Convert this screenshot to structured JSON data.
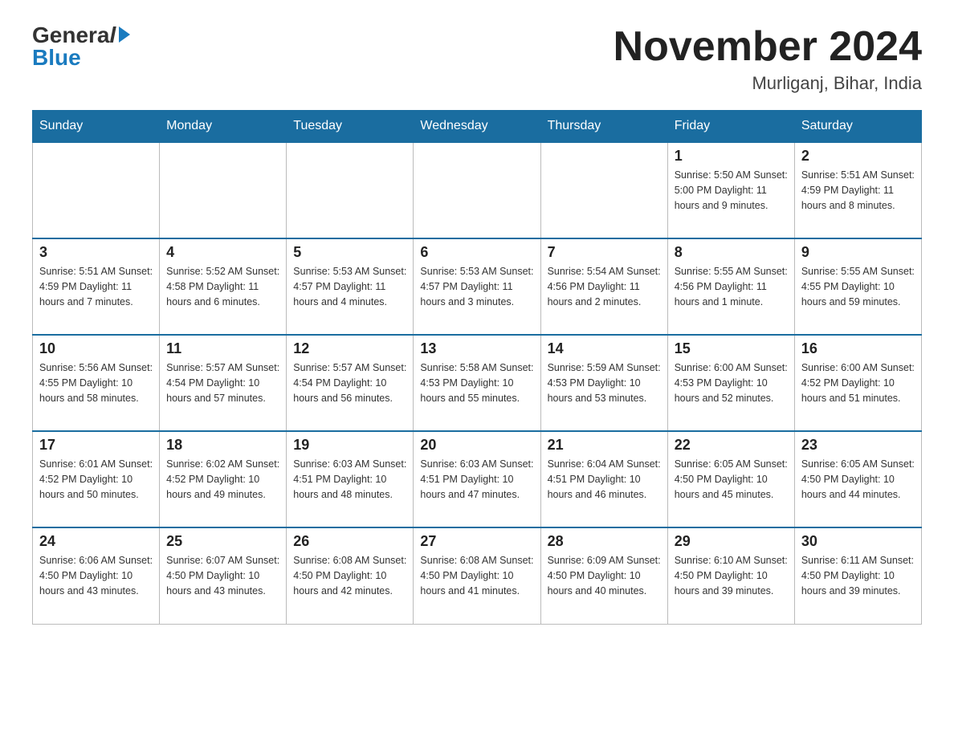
{
  "header": {
    "logo_general": "General",
    "logo_blue": "Blue",
    "month_title": "November 2024",
    "location": "Murliganj, Bihar, India"
  },
  "days_of_week": [
    "Sunday",
    "Monday",
    "Tuesday",
    "Wednesday",
    "Thursday",
    "Friday",
    "Saturday"
  ],
  "weeks": [
    [
      {
        "day": "",
        "info": "",
        "empty": true
      },
      {
        "day": "",
        "info": "",
        "empty": true
      },
      {
        "day": "",
        "info": "",
        "empty": true
      },
      {
        "day": "",
        "info": "",
        "empty": true
      },
      {
        "day": "",
        "info": "",
        "empty": true
      },
      {
        "day": "1",
        "info": "Sunrise: 5:50 AM\nSunset: 5:00 PM\nDaylight: 11 hours\nand 9 minutes."
      },
      {
        "day": "2",
        "info": "Sunrise: 5:51 AM\nSunset: 4:59 PM\nDaylight: 11 hours\nand 8 minutes."
      }
    ],
    [
      {
        "day": "3",
        "info": "Sunrise: 5:51 AM\nSunset: 4:59 PM\nDaylight: 11 hours\nand 7 minutes."
      },
      {
        "day": "4",
        "info": "Sunrise: 5:52 AM\nSunset: 4:58 PM\nDaylight: 11 hours\nand 6 minutes."
      },
      {
        "day": "5",
        "info": "Sunrise: 5:53 AM\nSunset: 4:57 PM\nDaylight: 11 hours\nand 4 minutes."
      },
      {
        "day": "6",
        "info": "Sunrise: 5:53 AM\nSunset: 4:57 PM\nDaylight: 11 hours\nand 3 minutes."
      },
      {
        "day": "7",
        "info": "Sunrise: 5:54 AM\nSunset: 4:56 PM\nDaylight: 11 hours\nand 2 minutes."
      },
      {
        "day": "8",
        "info": "Sunrise: 5:55 AM\nSunset: 4:56 PM\nDaylight: 11 hours\nand 1 minute."
      },
      {
        "day": "9",
        "info": "Sunrise: 5:55 AM\nSunset: 4:55 PM\nDaylight: 10 hours\nand 59 minutes."
      }
    ],
    [
      {
        "day": "10",
        "info": "Sunrise: 5:56 AM\nSunset: 4:55 PM\nDaylight: 10 hours\nand 58 minutes."
      },
      {
        "day": "11",
        "info": "Sunrise: 5:57 AM\nSunset: 4:54 PM\nDaylight: 10 hours\nand 57 minutes."
      },
      {
        "day": "12",
        "info": "Sunrise: 5:57 AM\nSunset: 4:54 PM\nDaylight: 10 hours\nand 56 minutes."
      },
      {
        "day": "13",
        "info": "Sunrise: 5:58 AM\nSunset: 4:53 PM\nDaylight: 10 hours\nand 55 minutes."
      },
      {
        "day": "14",
        "info": "Sunrise: 5:59 AM\nSunset: 4:53 PM\nDaylight: 10 hours\nand 53 minutes."
      },
      {
        "day": "15",
        "info": "Sunrise: 6:00 AM\nSunset: 4:53 PM\nDaylight: 10 hours\nand 52 minutes."
      },
      {
        "day": "16",
        "info": "Sunrise: 6:00 AM\nSunset: 4:52 PM\nDaylight: 10 hours\nand 51 minutes."
      }
    ],
    [
      {
        "day": "17",
        "info": "Sunrise: 6:01 AM\nSunset: 4:52 PM\nDaylight: 10 hours\nand 50 minutes."
      },
      {
        "day": "18",
        "info": "Sunrise: 6:02 AM\nSunset: 4:52 PM\nDaylight: 10 hours\nand 49 minutes."
      },
      {
        "day": "19",
        "info": "Sunrise: 6:03 AM\nSunset: 4:51 PM\nDaylight: 10 hours\nand 48 minutes."
      },
      {
        "day": "20",
        "info": "Sunrise: 6:03 AM\nSunset: 4:51 PM\nDaylight: 10 hours\nand 47 minutes."
      },
      {
        "day": "21",
        "info": "Sunrise: 6:04 AM\nSunset: 4:51 PM\nDaylight: 10 hours\nand 46 minutes."
      },
      {
        "day": "22",
        "info": "Sunrise: 6:05 AM\nSunset: 4:50 PM\nDaylight: 10 hours\nand 45 minutes."
      },
      {
        "day": "23",
        "info": "Sunrise: 6:05 AM\nSunset: 4:50 PM\nDaylight: 10 hours\nand 44 minutes."
      }
    ],
    [
      {
        "day": "24",
        "info": "Sunrise: 6:06 AM\nSunset: 4:50 PM\nDaylight: 10 hours\nand 43 minutes."
      },
      {
        "day": "25",
        "info": "Sunrise: 6:07 AM\nSunset: 4:50 PM\nDaylight: 10 hours\nand 43 minutes."
      },
      {
        "day": "26",
        "info": "Sunrise: 6:08 AM\nSunset: 4:50 PM\nDaylight: 10 hours\nand 42 minutes."
      },
      {
        "day": "27",
        "info": "Sunrise: 6:08 AM\nSunset: 4:50 PM\nDaylight: 10 hours\nand 41 minutes."
      },
      {
        "day": "28",
        "info": "Sunrise: 6:09 AM\nSunset: 4:50 PM\nDaylight: 10 hours\nand 40 minutes."
      },
      {
        "day": "29",
        "info": "Sunrise: 6:10 AM\nSunset: 4:50 PM\nDaylight: 10 hours\nand 39 minutes."
      },
      {
        "day": "30",
        "info": "Sunrise: 6:11 AM\nSunset: 4:50 PM\nDaylight: 10 hours\nand 39 minutes."
      }
    ]
  ]
}
